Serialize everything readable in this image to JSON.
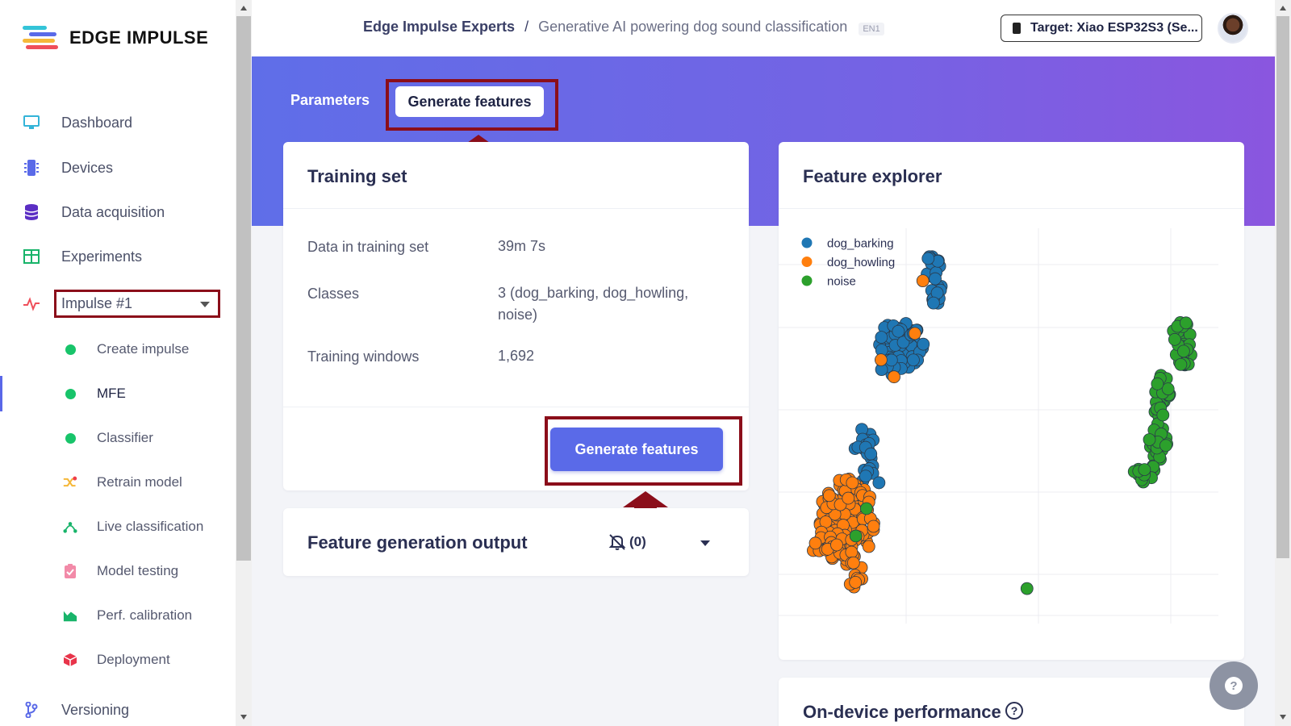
{
  "brand": {
    "name": "EDGE IMPULSE"
  },
  "sidebar": {
    "items": [
      {
        "label": "Dashboard"
      },
      {
        "label": "Devices"
      },
      {
        "label": "Data acquisition"
      },
      {
        "label": "Experiments"
      }
    ],
    "impulse_select": "Impulse #1",
    "subitems": [
      {
        "label": "Create impulse"
      },
      {
        "label": "MFE"
      },
      {
        "label": "Classifier"
      },
      {
        "label": "Retrain model"
      },
      {
        "label": "Live classification"
      },
      {
        "label": "Model testing"
      },
      {
        "label": "Perf. calibration"
      },
      {
        "label": "Deployment"
      }
    ],
    "versioning": "Versioning"
  },
  "header": {
    "breadcrumb_owner": "Edge Impulse Experts",
    "breadcrumb_sep": "/",
    "breadcrumb_project": "Generative AI powering dog sound classification",
    "breadcrumb_badge": "EN1",
    "target": "Target: Xiao ESP32S3 (Se..."
  },
  "tabs": {
    "parameters": "Parameters",
    "generate": "Generate features"
  },
  "training_set": {
    "title": "Training set",
    "rows": [
      {
        "label": "Data in training set",
        "value": "39m 7s"
      },
      {
        "label": "Classes",
        "value": "3 (dog_barking, dog_howling,",
        "value2": "noise)"
      },
      {
        "label": "Training windows",
        "value": "1,692"
      }
    ],
    "button": "Generate features"
  },
  "feature_output": {
    "title": "Feature generation output",
    "count": "(0)"
  },
  "feature_explorer": {
    "title": "Feature explorer",
    "legend": [
      {
        "name": "dog_barking",
        "color": "#1f77b4"
      },
      {
        "name": "dog_howling",
        "color": "#ff7f0e"
      },
      {
        "name": "noise",
        "color": "#2ca02c"
      }
    ]
  },
  "performance": {
    "title": "On-device performance",
    "help": "?"
  },
  "help_fab": "?",
  "colors": {
    "accent": "#5a6ae8",
    "annotation": "#8b0e1a",
    "active": "#18c46a"
  }
}
